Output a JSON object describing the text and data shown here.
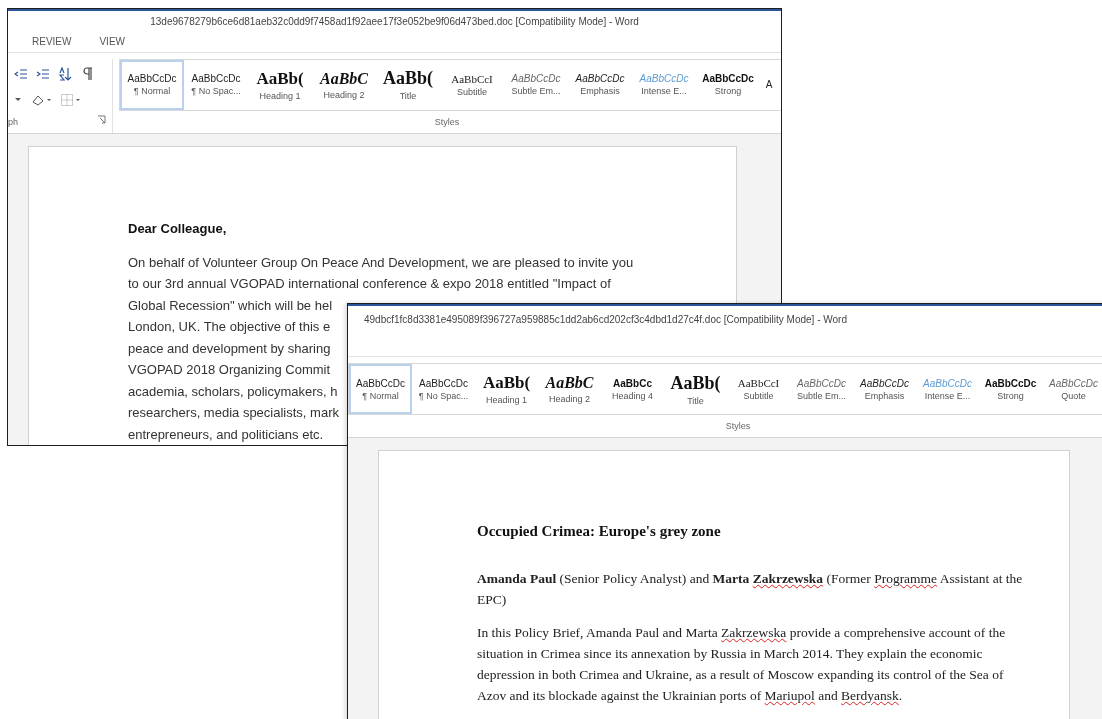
{
  "windows": [
    {
      "title": "13de9678279b6ce6d81aeb32c0dd9f7458ad1f92aee17f3e052be9f06d473bed.doc [Compatibility Mode] - Word",
      "tabs": [
        {
          "label": "REVIEW",
          "selected": false
        },
        {
          "label": "VIEW",
          "selected": false
        }
      ],
      "left_group_label": "ph",
      "styles_group_label": "Styles",
      "styles": [
        {
          "preview": "AaBbCcDc",
          "label": "¶ Normal",
          "kind": "normal",
          "selected": true
        },
        {
          "preview": "AaBbCcDc",
          "label": "¶ No Spac...",
          "kind": "normal",
          "selected": false
        },
        {
          "preview": "AaBb(",
          "label": "Heading 1",
          "kind": "heading1",
          "selected": false
        },
        {
          "preview": "AaBbC",
          "label": "Heading 2",
          "kind": "heading2",
          "selected": false
        },
        {
          "preview": "AaBb(",
          "label": "Title",
          "kind": "title",
          "selected": false
        },
        {
          "preview": "AaBbCcI",
          "label": "Subtitle",
          "kind": "subtitle",
          "selected": false
        },
        {
          "preview": "AaBbCcDc",
          "label": "Subtle Em...",
          "kind": "subtle",
          "selected": false
        },
        {
          "preview": "AaBbCcDc",
          "label": "Emphasis",
          "kind": "emphasis",
          "selected": false
        },
        {
          "preview": "AaBbCcDc",
          "label": "Intense E...",
          "kind": "intense",
          "selected": false
        },
        {
          "preview": "AaBbCcDc",
          "label": "Strong",
          "kind": "strong",
          "selected": false
        },
        {
          "preview": "A",
          "kind": "normal",
          "selected": false
        }
      ],
      "document": {
        "kind": "letter",
        "blocks": [
          {
            "kind": "heading",
            "lines": [
              "Dear Colleague,"
            ]
          },
          {
            "kind": "lines",
            "lines": [
              "On behalf of Volunteer Group On Peace And Development, we are pleased to invite you",
              "to our 3rd annual VGOPAD international conference & expo 2018 entitled \"Impact of",
              "Global Recession\" which will be hel",
              "London, UK. The objective of this e",
              "peace and development by sharing",
              "VGOPAD 2018 Organizing Commit",
              "academia, scholars, policymakers, h",
              "researchers, media specialists, mark",
              "entrepreneurs, and politicians etc."
            ]
          }
        ]
      }
    },
    {
      "title": "49dbcf1fc8d3381e495089f396727a959885c1dd2ab6cd202cf3c4dbd1d27c4f.doc [Compatibility Mode] - Word",
      "styles_group_label": "Styles",
      "styles": [
        {
          "preview": "AaBbCcDc",
          "label": "¶ Normal",
          "kind": "normal",
          "selected": true
        },
        {
          "preview": "AaBbCcDc",
          "label": "¶ No Spac...",
          "kind": "normal",
          "selected": false
        },
        {
          "preview": "AaBb(",
          "label": "Heading 1",
          "kind": "heading1",
          "selected": false
        },
        {
          "preview": "AaBbC",
          "label": "Heading 2",
          "kind": "heading2",
          "selected": false
        },
        {
          "preview": "AaBbCc",
          "label": "Heading 4",
          "kind": "strong",
          "selected": false
        },
        {
          "preview": "AaBb(",
          "label": "Title",
          "kind": "title",
          "selected": false
        },
        {
          "preview": "AaBbCcI",
          "label": "Subtitle",
          "kind": "subtitle",
          "selected": false
        },
        {
          "preview": "AaBbCcDc",
          "label": "Subtle Em...",
          "kind": "subtle",
          "selected": false
        },
        {
          "preview": "AaBbCcDc",
          "label": "Emphasis",
          "kind": "emphasis",
          "selected": false
        },
        {
          "preview": "AaBbCcDc",
          "label": "Intense E...",
          "kind": "intense",
          "selected": false
        },
        {
          "preview": "AaBbCcDc",
          "label": "Strong",
          "kind": "strong",
          "selected": false
        },
        {
          "preview": "AaBbCcDc",
          "label": "Quote",
          "kind": "subtle",
          "selected": false
        }
      ],
      "document": {
        "kind": "brief",
        "blocks": [
          {
            "kind": "heading",
            "lines": [
              "Occupied Crimea: Europe's grey zone"
            ]
          },
          {
            "kind": "rich",
            "segments": [
              {
                "text": "Amanda Paul",
                "bold": true,
                "misspelled": false
              },
              {
                "text": " (Senior Policy Analyst) and ",
                "bold": false,
                "misspelled": false
              },
              {
                "text": "Marta ",
                "bold": true,
                "misspelled": false
              },
              {
                "text": "Zakrzewska",
                "bold": true,
                "misspelled": true
              },
              {
                "text": " (Former ",
                "bold": false,
                "misspelled": false
              },
              {
                "text": "Programme",
                "bold": false,
                "misspelled": true
              },
              {
                "text": " Assistant at the EPC)",
                "bold": false,
                "misspelled": false
              }
            ]
          },
          {
            "kind": "rich",
            "segments": [
              {
                "text": "In this Policy Brief, Amanda Paul and Marta ",
                "bold": false,
                "misspelled": false
              },
              {
                "text": "Zakrzewska",
                "bold": false,
                "misspelled": true
              },
              {
                "text": " provide a comprehensive account of the situation in Crimea since its annexation by Russia in March 2014. They explain the economic depression in both Crimea and Ukraine, as a result of Moscow expanding its control of the Sea of Azov and its blockade against the Ukrainian ports of ",
                "bold": false,
                "misspelled": false
              },
              {
                "text": "Mariupol",
                "bold": false,
                "misspelled": true
              },
              {
                "text": " and ",
                "bold": false,
                "misspelled": false
              },
              {
                "text": "Berdyansk",
                "bold": false,
                "misspelled": true
              },
              {
                "text": ".",
                "bold": false,
                "misspelled": false
              }
            ]
          }
        ]
      }
    }
  ]
}
